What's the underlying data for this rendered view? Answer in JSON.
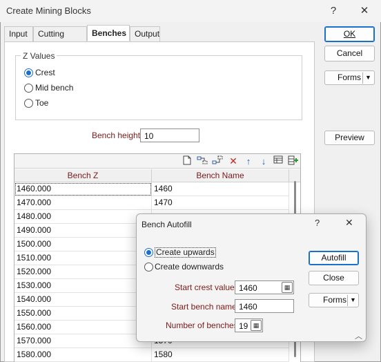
{
  "window": {
    "title": "Create Mining Blocks",
    "help_symbol": "?",
    "close_symbol": "✕"
  },
  "tabs": [
    "Input",
    "Cutting Profile",
    "Benches",
    "Output"
  ],
  "z_values": {
    "group_label": "Z Values",
    "options": [
      "Crest",
      "Mid bench",
      "Toe"
    ],
    "selected": "Crest"
  },
  "bench_height": {
    "label": "Bench height",
    "value": "10"
  },
  "table": {
    "columns": [
      "Bench Z",
      "Bench Name"
    ],
    "rows": [
      [
        "1460.000",
        "1460"
      ],
      [
        "1470.000",
        "1470"
      ],
      [
        "1480.000",
        ""
      ],
      [
        "1490.000",
        ""
      ],
      [
        "1500.000",
        ""
      ],
      [
        "1510.000",
        ""
      ],
      [
        "1520.000",
        ""
      ],
      [
        "1530.000",
        ""
      ],
      [
        "1540.000",
        ""
      ],
      [
        "1550.000",
        ""
      ],
      [
        "1560.000",
        ""
      ],
      [
        "1570.000",
        "1570"
      ],
      [
        "1580.000",
        "1580"
      ]
    ],
    "toolbar_icons": [
      "new-page-icon",
      "insert-row-icon",
      "insert-after-icon",
      "delete-icon",
      "move-up-icon",
      "move-down-icon",
      "table-icon",
      "add-column-icon"
    ]
  },
  "side_buttons": {
    "ok": "OK",
    "cancel": "Cancel",
    "forms": "Forms",
    "preview": "Preview"
  },
  "dialog": {
    "title": "Bench Autofill",
    "help_symbol": "?",
    "close_symbol": "✕",
    "options": [
      "Create upwards",
      "Create downwards"
    ],
    "selected": "Create upwards",
    "start_crest_value": {
      "label": "Start crest value",
      "value": "1460"
    },
    "start_bench_name": {
      "label": "Start bench name",
      "value": "1460"
    },
    "number_of_benches": {
      "label": "Number of benches",
      "value": "19"
    },
    "buttons": {
      "autofill": "Autofill",
      "close": "Close",
      "forms": "Forms"
    }
  },
  "colors": {
    "accent": "#1a6fc9",
    "label_red": "#7a1a1a"
  }
}
